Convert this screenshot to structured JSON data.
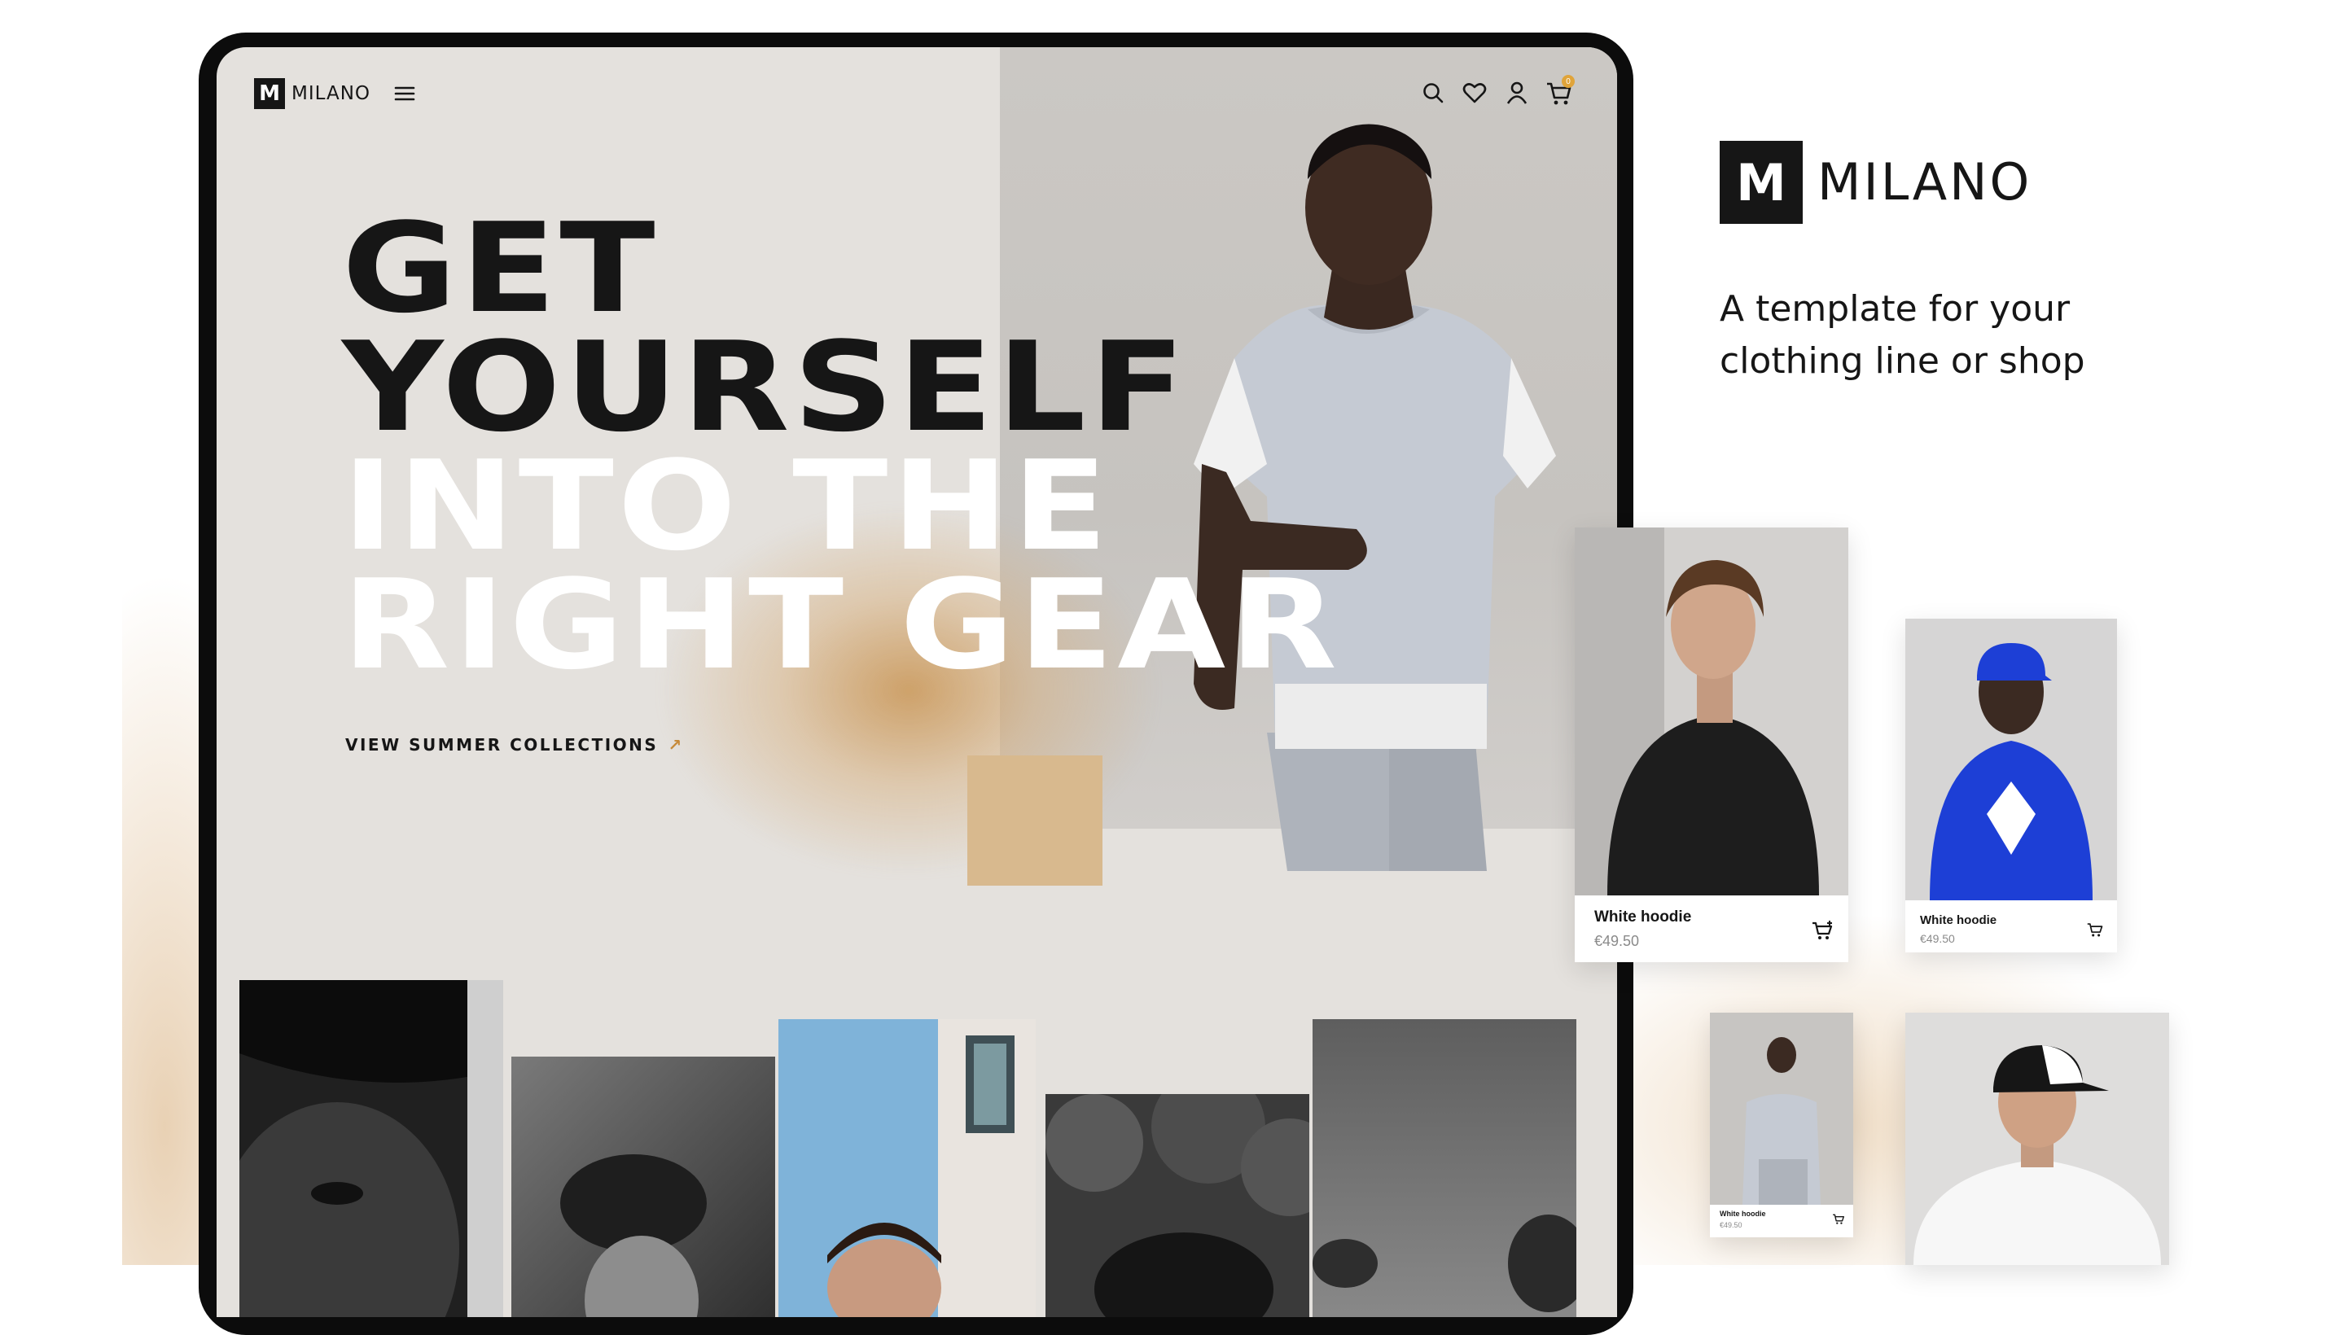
{
  "colors": {
    "ink": "#161616",
    "screen_bg": "#e4e1dd",
    "accent_tan": "#d8b98e",
    "accent_orange": "#c68a3a",
    "hoodie_blue": "#1d3fd6",
    "cart_badge": "#e0a43a"
  },
  "nav": {
    "logo_mark": "M",
    "logo_text": "MILANO",
    "menu_icon": "hamburger-menu-icon",
    "icons": [
      "search-icon",
      "heart-icon",
      "user-icon",
      "cart-icon"
    ],
    "cart_count": "0"
  },
  "hero": {
    "line1": "GET",
    "line2": "YOURSELF",
    "line3": "INTO THE",
    "line4": "RIGHT GEAR",
    "cta_label": "VIEW SUMMER COLLECTIONS",
    "cta_icon": "arrow-up-right-icon"
  },
  "brand": {
    "mark": "M",
    "name": "MILANO",
    "tagline": "A template for your clothing line or shop"
  },
  "products": [
    {
      "name": "White hoodie",
      "price": "€49.50"
    },
    {
      "name": "White hoodie",
      "price": "€49.50"
    },
    {
      "name": "White hoodie",
      "price": "€49.50"
    }
  ]
}
